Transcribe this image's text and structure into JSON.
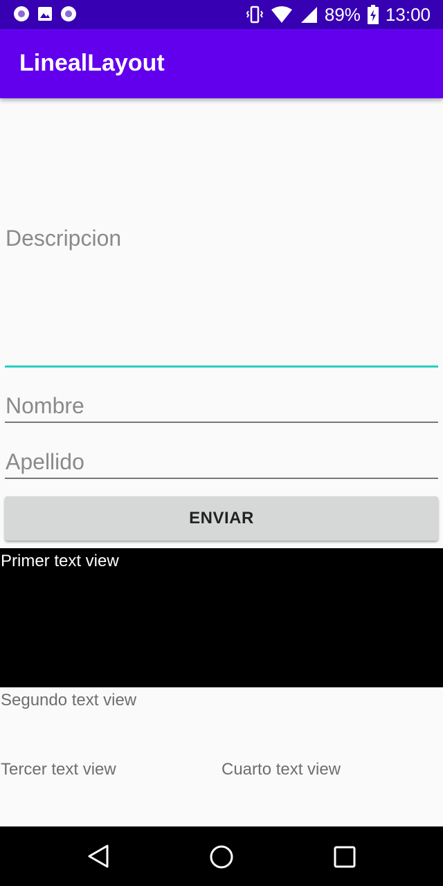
{
  "status_bar": {
    "battery": "89%",
    "time": "13:00"
  },
  "app_bar": {
    "title": "LinealLayout"
  },
  "form": {
    "descripcion_hint": "Descripcion",
    "nombre_hint": "Nombre",
    "apellido_hint": "Apellido",
    "submit_label": "ENVIAR"
  },
  "text_views": {
    "primer": "Primer text view",
    "segundo": "Segundo text view",
    "tercer": "Tercer text view",
    "cuarto": "Cuarto text view"
  },
  "colors": {
    "status_bar": "#3700b3",
    "app_bar": "#6200ee",
    "focus_accent": "#26d0c0",
    "button_bg": "#d6d7d7"
  },
  "icons": [
    "notification-dot-icon",
    "image-icon",
    "vibrate-icon",
    "wifi-icon",
    "signal-icon",
    "battery-charging-icon",
    "back-icon",
    "home-icon",
    "recents-icon"
  ]
}
